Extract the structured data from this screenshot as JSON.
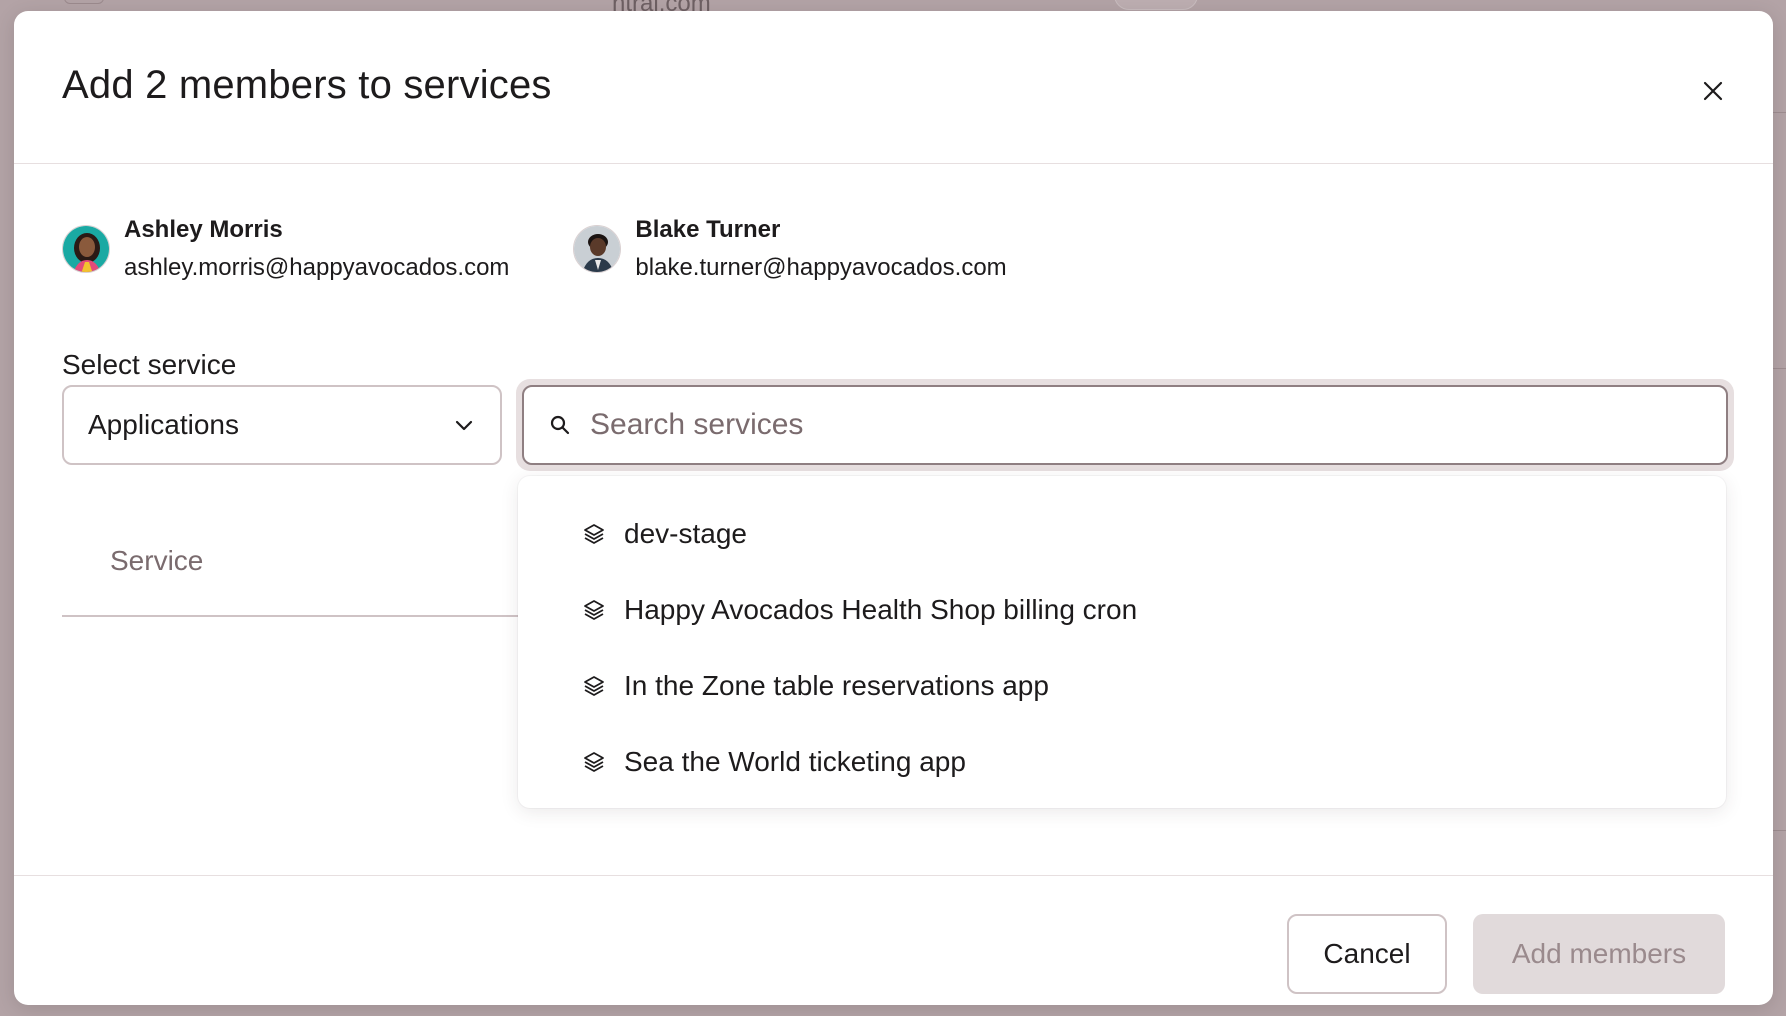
{
  "background": {
    "snippet": "ntral.com"
  },
  "modal": {
    "title": "Add 2 members to services",
    "members": [
      {
        "name": "Ashley Morris",
        "email": "ashley.morris@happyavocados.com"
      },
      {
        "name": "Blake Turner",
        "email": "blake.turner@happyavocados.com"
      }
    ],
    "select": {
      "label": "Select service",
      "value": "Applications"
    },
    "search": {
      "placeholder": "Search services",
      "value": ""
    },
    "table": {
      "columns": [
        "Service"
      ]
    },
    "dropdown": {
      "items": [
        {
          "label": "dev-stage",
          "icon": "layers-icon"
        },
        {
          "label": "Happy Avocados Health Shop billing cron",
          "icon": "layers-icon"
        },
        {
          "label": "In the Zone table reservations app",
          "icon": "layers-icon"
        },
        {
          "label": "Sea the World ticketing app",
          "icon": "layers-icon"
        }
      ]
    },
    "footer": {
      "cancel_label": "Cancel",
      "add_label": "Add members"
    }
  },
  "colors": {
    "overlay": "#b3a3a6",
    "border": "#cfc3c5",
    "disabled_bg": "#e1dadb",
    "disabled_text": "#9a8a8d"
  }
}
